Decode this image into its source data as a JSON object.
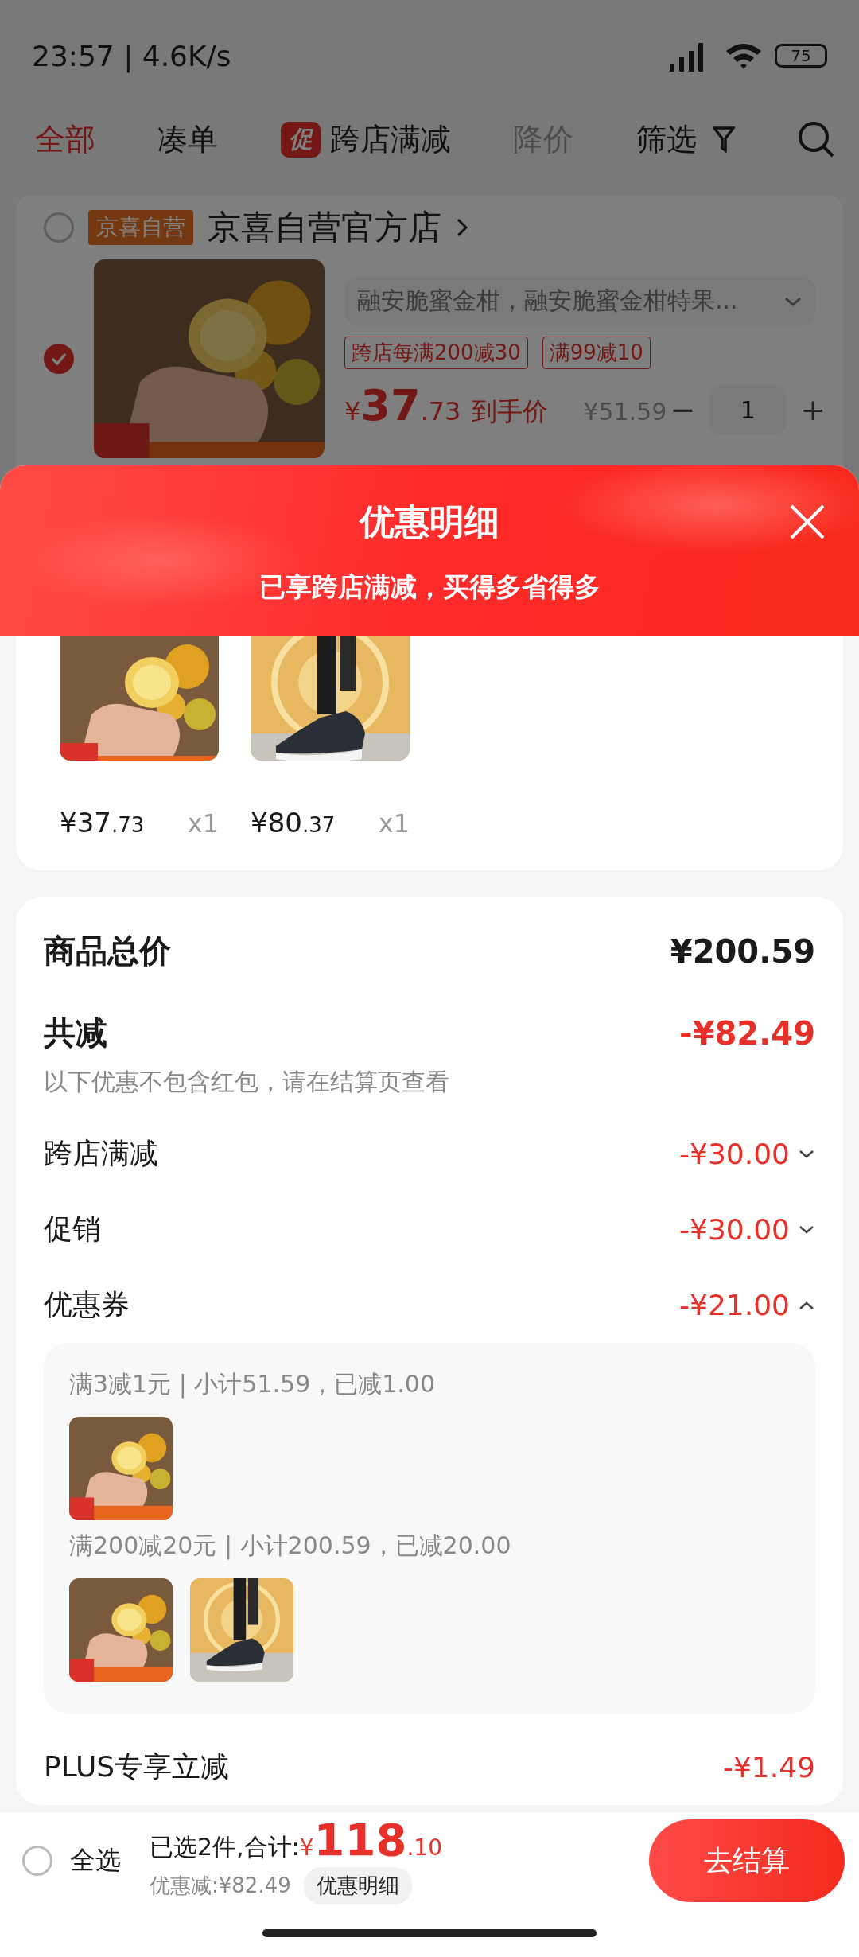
{
  "status_bar": {
    "time": "23:57 | 4.6K/s",
    "battery": "75"
  },
  "tabs": [
    {
      "label": "全部",
      "selected": true,
      "disabled": false
    },
    {
      "label": "凑单",
      "selected": false,
      "disabled": false
    },
    {
      "label": "跨店满减",
      "badge": "促",
      "selected": false,
      "disabled": false
    },
    {
      "label": "降价",
      "selected": false,
      "disabled": true
    }
  ],
  "filter": {
    "label": "筛选"
  },
  "store": {
    "selected": false,
    "tag": "京喜自营",
    "name": "京喜自营官方店"
  },
  "product": {
    "selected": true,
    "spec": "融安脆蜜金柑，融安脆蜜金柑特果...",
    "promos": [
      "跨店每满200减30",
      "满99减10"
    ],
    "currency": "¥",
    "price_int": "37",
    "price_dec": ".73",
    "price_label": "到手价",
    "original_price": "¥51.59",
    "minus": "−",
    "quantity": "1",
    "plus": "+"
  },
  "sheet": {
    "title": "优惠明细",
    "subtitle": "已享跨店满减，买得多省得多",
    "items": [
      {
        "price_int": "¥37",
        "price_dec": ".73",
        "quantity": "x1"
      },
      {
        "price_int": "¥80",
        "price_dec": ".37",
        "quantity": "x1"
      }
    ]
  },
  "summary": {
    "total_label": "商品总价",
    "total": "¥200.59",
    "discount_label": "共减",
    "discount": "-¥82.49",
    "note": "以下优惠不包含红包，请在结算页查看",
    "rows": [
      {
        "kind": "expandable",
        "label": "跨店满减",
        "amount": "-¥30.00",
        "expanded": false
      },
      {
        "kind": "expandable",
        "label": "促销",
        "amount": "-¥30.00",
        "expanded": false
      },
      {
        "kind": "expandable",
        "label": "优惠券",
        "amount": "-¥21.00",
        "expanded": true,
        "groups": [
          {
            "text": "满3减1元 | 小计51.59，已减1.00"
          },
          {
            "text": "满200减20元 | 小计200.59，已减20.00"
          }
        ]
      },
      {
        "kind": "plain",
        "label": "PLUS专享立减",
        "amount": "-¥1.49"
      }
    ]
  },
  "bottom_bar": {
    "select_all": {
      "label": "全选",
      "checked": false
    },
    "selected_text": "已选2件,合计:",
    "currency": "¥",
    "total_int": "118",
    "total_dec": ".10",
    "saved": "优惠减:¥82.49",
    "detail_button": "优惠明细",
    "checkout": "去结算"
  }
}
